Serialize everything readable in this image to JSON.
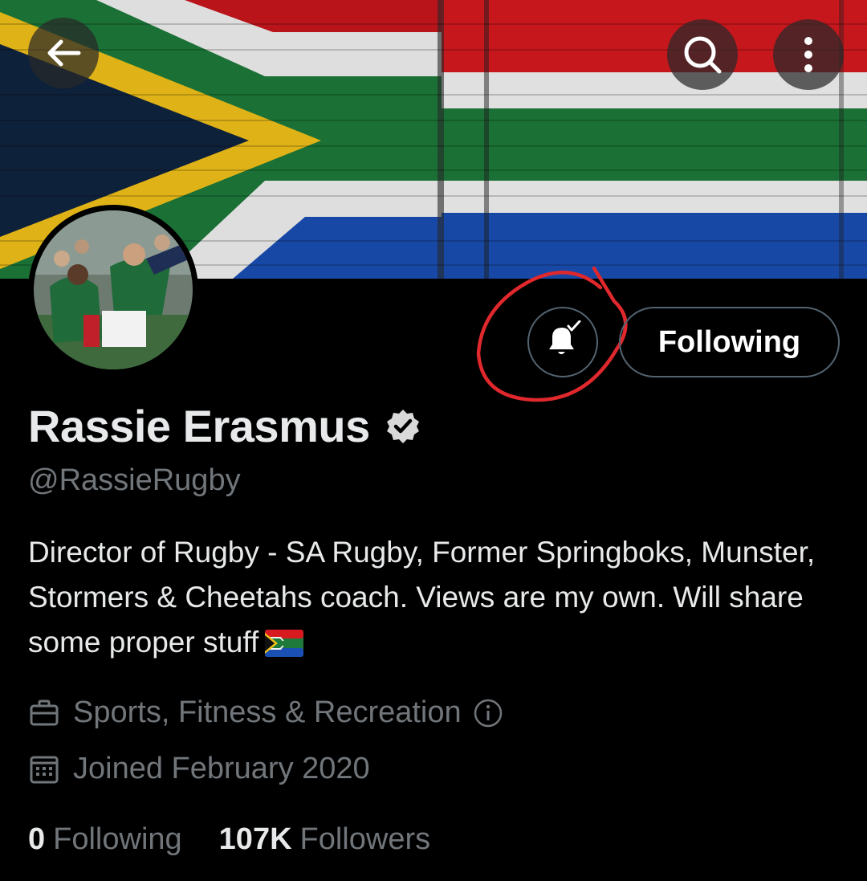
{
  "profile": {
    "display_name": "Rassie Erasmus",
    "handle": "@RassieRugby",
    "bio": "Director of Rugby - SA Rugby, Former Springboks, Munster, Stormers & Cheetahs coach. Views are my own. Will share some proper stuff",
    "category": "Sports, Fitness & Recreation",
    "joined": "Joined February 2020",
    "verified": true
  },
  "actions": {
    "following_label": "Following",
    "notifications_state": "bell-check-icon"
  },
  "stats": {
    "following_count": "0",
    "following_label": "Following",
    "followers_count": "107K",
    "followers_label": "Followers"
  },
  "icons": {
    "back": "arrow-left-icon",
    "search": "search-icon",
    "more": "more-vertical-icon",
    "category": "briefcase-icon",
    "joined": "calendar-icon",
    "info": "info-icon",
    "verified": "verified-badge-icon",
    "flag": "south-africa-flag-emoji"
  },
  "colors": {
    "background": "#000000",
    "text_primary": "#e7e9ea",
    "text_secondary": "#71767b",
    "button_border": "#536471",
    "annotation": "#e0282d"
  }
}
